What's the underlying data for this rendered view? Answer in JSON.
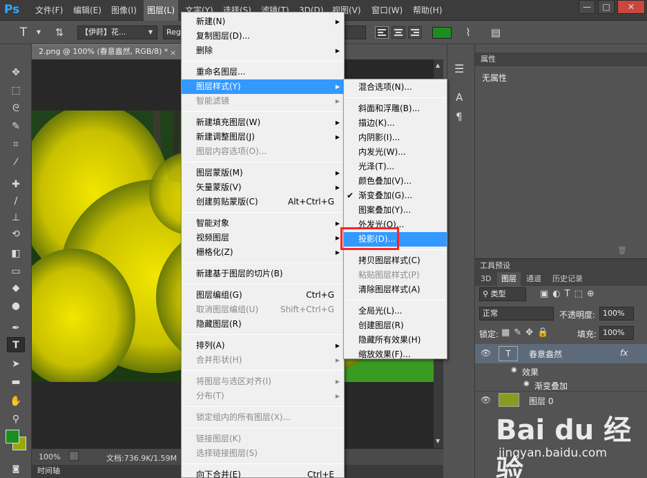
{
  "app": {
    "logo": "Ps"
  },
  "menubar": {
    "items": [
      "文件(F)",
      "编辑(E)",
      "图像(I)",
      "图层(L)",
      "文字(Y)",
      "选择(S)",
      "滤镜(T)",
      "3D(D)",
      "视图(V)",
      "窗口(W)",
      "帮助(H)"
    ],
    "window_buttons": [
      "—",
      "□",
      "✕"
    ]
  },
  "options": {
    "font_family": "【伊莳】花...",
    "font_style": "Reg",
    "colors": {
      "text_color": "#1f8c1f",
      "accent": "#3399ff",
      "highlight_box": "#ff2222"
    }
  },
  "document": {
    "tab_title": "2.png @ 100% (春意盎然, RGB/8) *",
    "close": "×",
    "zoom": "100%",
    "file_info": "文档:736.9K/1.59M",
    "timeline": "时间轴"
  },
  "layer_menu": {
    "items": [
      {
        "label": "新建(N)",
        "arrow": true
      },
      {
        "label": "复制图层(D)..."
      },
      {
        "label": "删除",
        "arrow": true
      },
      {
        "sep": true
      },
      {
        "label": "重命名图层..."
      },
      {
        "label": "图层样式(Y)",
        "arrow": true,
        "highlight": true
      },
      {
        "label": "智能滤镜",
        "arrow": true,
        "disabled": true
      },
      {
        "sep": true
      },
      {
        "label": "新建填充图层(W)",
        "arrow": true
      },
      {
        "label": "新建调整图层(J)",
        "arrow": true
      },
      {
        "label": "图层内容选项(O)...",
        "disabled": true
      },
      {
        "sep": true
      },
      {
        "label": "图层蒙版(M)",
        "arrow": true
      },
      {
        "label": "矢量蒙版(V)",
        "arrow": true
      },
      {
        "label": "创建剪贴蒙版(C)",
        "shortcut": "Alt+Ctrl+G"
      },
      {
        "sep": true
      },
      {
        "label": "智能对象",
        "arrow": true
      },
      {
        "label": "视频图层",
        "arrow": true
      },
      {
        "label": "栅格化(Z)",
        "arrow": true
      },
      {
        "sep": true
      },
      {
        "label": "新建基于图层的切片(B)"
      },
      {
        "sep": true
      },
      {
        "label": "图层编组(G)",
        "shortcut": "Ctrl+G"
      },
      {
        "label": "取消图层编组(U)",
        "shortcut": "Shift+Ctrl+G",
        "disabled": true
      },
      {
        "label": "隐藏图层(R)"
      },
      {
        "sep": true
      },
      {
        "label": "排列(A)",
        "arrow": true
      },
      {
        "label": "合并形状(H)",
        "arrow": true,
        "disabled": true
      },
      {
        "sep": true
      },
      {
        "label": "将图层与选区对齐(I)",
        "arrow": true,
        "disabled": true
      },
      {
        "label": "分布(T)",
        "arrow": true,
        "disabled": true
      },
      {
        "sep": true
      },
      {
        "label": "锁定组内的所有图层(X)...",
        "disabled": true
      },
      {
        "sep": true
      },
      {
        "label": "链接图层(K)",
        "disabled": true
      },
      {
        "label": "选择链接图层(S)",
        "disabled": true
      },
      {
        "sep": true
      },
      {
        "label": "向下合并(E)",
        "shortcut": "Ctrl+E"
      }
    ]
  },
  "style_menu": {
    "items": [
      {
        "label": "混合选项(N)..."
      },
      {
        "sep": true
      },
      {
        "label": "斜面和浮雕(B)..."
      },
      {
        "label": "描边(K)..."
      },
      {
        "label": "内阴影(I)..."
      },
      {
        "label": "内发光(W)..."
      },
      {
        "label": "光泽(T)..."
      },
      {
        "label": "颜色叠加(V)..."
      },
      {
        "label": "渐变叠加(G)...",
        "checked": true
      },
      {
        "label": "图案叠加(Y)..."
      },
      {
        "label": "外发光(O)..."
      },
      {
        "label": "投影(D)...",
        "highlight": true
      },
      {
        "sep": true
      },
      {
        "label": "拷贝图层样式(C)"
      },
      {
        "label": "粘贴图层样式(P)",
        "disabled": true
      },
      {
        "label": "清除图层样式(A)"
      },
      {
        "sep": true
      },
      {
        "label": "全局光(L)..."
      },
      {
        "label": "创建图层(R)"
      },
      {
        "label": "隐藏所有效果(H)"
      },
      {
        "label": "缩放效果(F)..."
      }
    ]
  },
  "properties": {
    "title": "属性",
    "empty": "无属性"
  },
  "presets": {
    "title": "工具预设"
  },
  "layers_panel": {
    "tabs": [
      "3D",
      "图层",
      "通道",
      "历史记录"
    ],
    "filter": "类型",
    "blend_mode": "正常",
    "opacity_label": "不透明度:",
    "opacity": "100%",
    "lock_label": "锁定:",
    "fill_label": "填充:",
    "fill": "100%",
    "text_layer": "春意盎然",
    "fx": "fx",
    "effects_label": "效果",
    "effect_name": "渐变叠加",
    "image_layer": "图层 0",
    "text_thumb": "T"
  },
  "watermark": {
    "brand": "Bai du 经验",
    "url": "jingyan.baidu.com"
  }
}
